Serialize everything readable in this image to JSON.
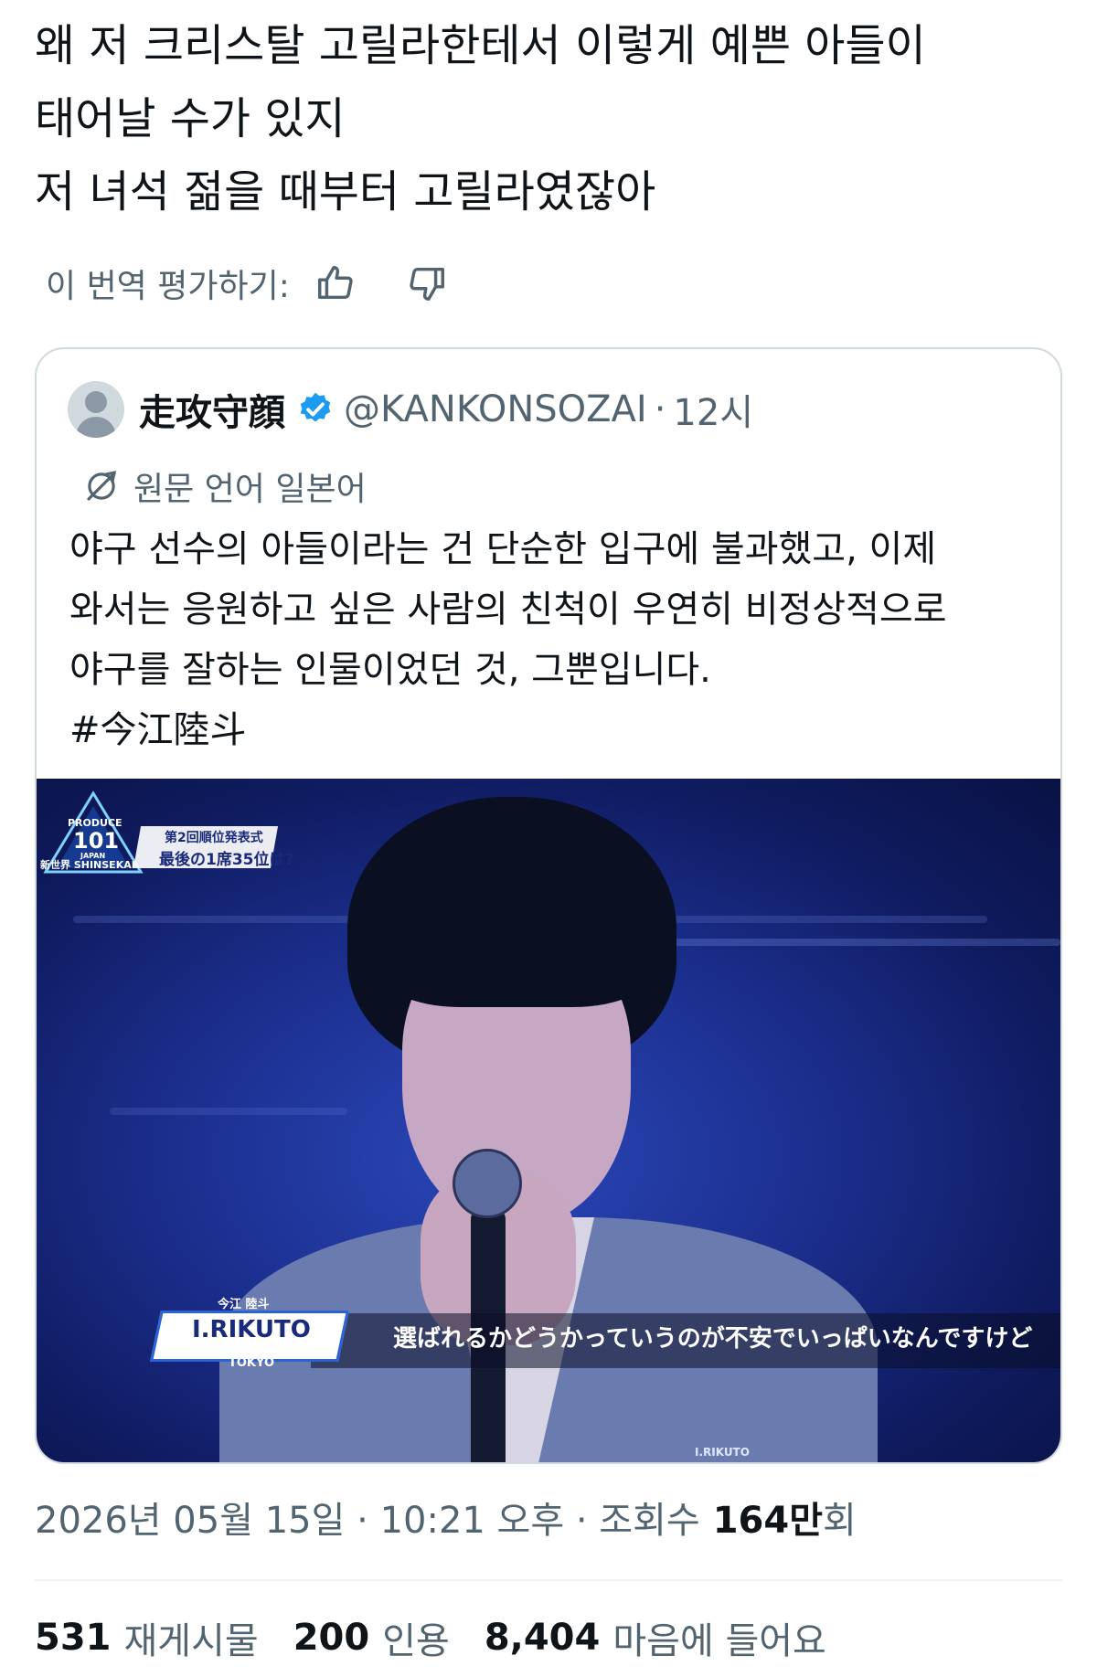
{
  "tweet": {
    "lines": [
      "왜 저 크리스탈 고릴라한테서 이렇게 예쁜 아들이",
      "태어날 수가 있지",
      "저 녀석 젊을 때부터 고릴라였잖아"
    ],
    "rate_label": "이 번역 평가하기:"
  },
  "quote": {
    "name": "走攻守顔",
    "handle": "@KANKONSOZAI",
    "dot": "·",
    "time": "12시",
    "lang_note": "원문 언어 일본어",
    "lines": [
      "야구 선수의 아들이라는 건 단순한 입구에 불과했고, 이제",
      "와서는 응원하고 싶은 사람의 친척이 우연히 비정상적으로",
      "야구를 잘하는 인물이었던 것, 그뿐입니다."
    ],
    "hashtag": "#今江陸斗",
    "media": {
      "logo_top": "PRODUCE",
      "logo_num": "101",
      "logo_japan": "JAPAN",
      "logo_shinsekai": "新世界 SHINSEKAI",
      "ranking_line1": "第2回順位発表式",
      "ranking_line2": "最後の1席35位は?",
      "name_small": "今江 陸斗",
      "name_main": "I.RIKUTO",
      "name_city": "TOKYO",
      "subtitle": "選ばれるかどうかっていうのが不安でいっぱいなんですけど",
      "lower_tag": "I.RIKUTO"
    }
  },
  "meta": {
    "datetime": "2026년 05월 15일 · 10:21 오후 · 조회수",
    "views_num": "164만",
    "views_unit": "회"
  },
  "stats": {
    "retweets_num": "531",
    "retweets_label": "재게시물",
    "quotes_num": "200",
    "quotes_label": "인용",
    "likes_num": "8,404",
    "likes_label": "마음에 들어요"
  },
  "colors": {
    "text": "#0f1419",
    "secondary": "#536471",
    "verified": "#1d9bf0",
    "border": "#cfd9de"
  },
  "icons": [
    "thumbs-up-icon",
    "thumbs-down-icon",
    "verified-badge-icon",
    "translate-icon",
    "avatar-icon"
  ]
}
